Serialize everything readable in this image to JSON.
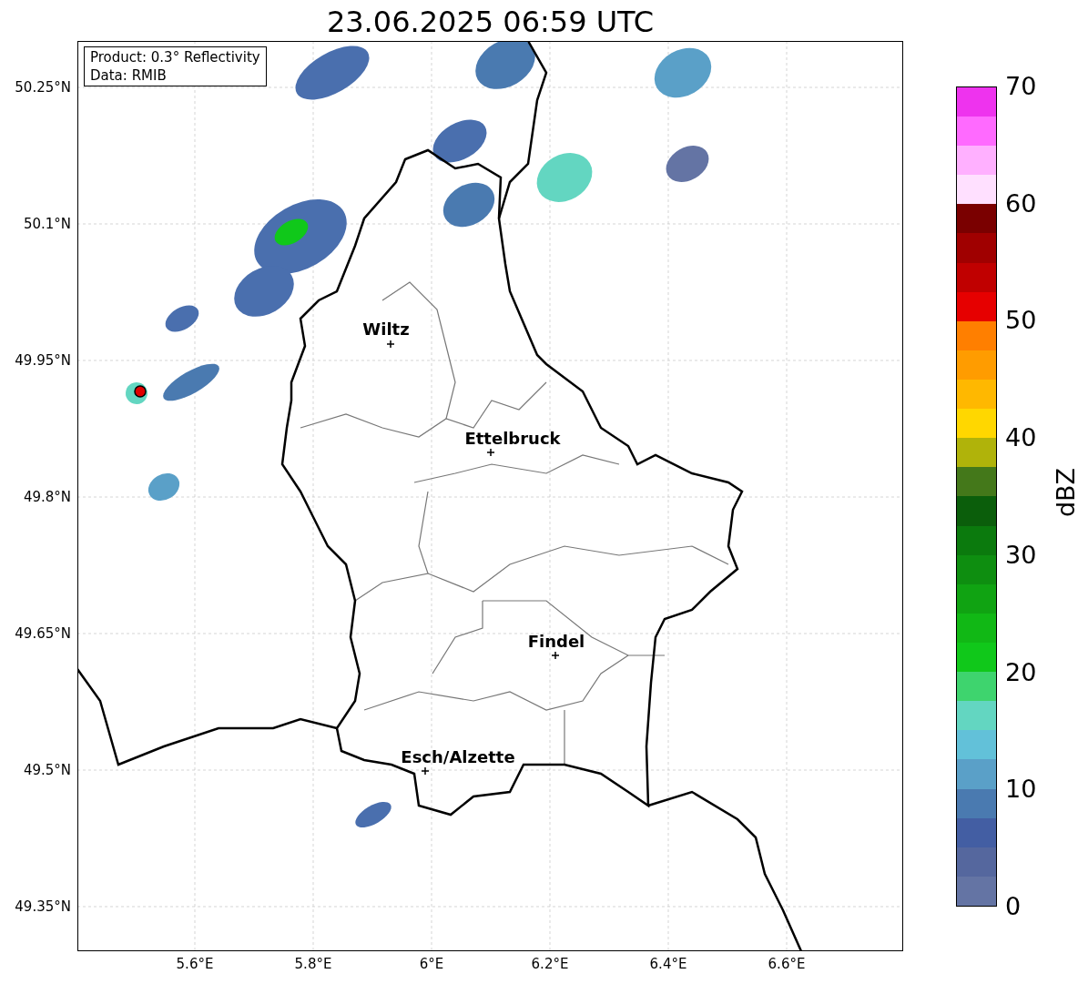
{
  "title": "23.06.2025 06:59 UTC",
  "info_box": [
    "Product: 0.3° Reflectivity",
    "Data: RMIB"
  ],
  "y_ticks": [
    "50.25°N",
    "50.1°N",
    "49.95°N",
    "49.8°N",
    "49.65°N",
    "49.5°N",
    "49.35°N"
  ],
  "x_ticks": [
    "5.6°E",
    "5.8°E",
    "6°E",
    "6.2°E",
    "6.4°E",
    "6.6°E"
  ],
  "cities": [
    {
      "name": "Wiltz"
    },
    {
      "name": "Ettelbruck"
    },
    {
      "name": "Findel"
    },
    {
      "name": "Esch/Alzette"
    }
  ],
  "colorbar": {
    "label": "dBZ",
    "ticks": [
      "70",
      "60",
      "50",
      "40",
      "30",
      "20",
      "10",
      "0"
    ],
    "bands": [
      {
        "color": "#6474a4"
      },
      {
        "color": "#55679e"
      },
      {
        "color": "#435ea3"
      },
      {
        "color": "#4a7ab0"
      },
      {
        "color": "#5aa0c8"
      },
      {
        "color": "#62c1d9"
      },
      {
        "color": "#63d6c1"
      },
      {
        "color": "#3ed46e"
      },
      {
        "color": "#10c81a"
      },
      {
        "color": "#11b815"
      },
      {
        "color": "#10a312"
      },
      {
        "color": "#0e8e10"
      },
      {
        "color": "#0b7a0d"
      },
      {
        "color": "#0b5e0b"
      },
      {
        "color": "#44781a"
      },
      {
        "color": "#b0b30a"
      },
      {
        "color": "#ffd700"
      },
      {
        "color": "#ffb800"
      },
      {
        "color": "#ff9c00"
      },
      {
        "color": "#ff7f00"
      },
      {
        "color": "#e60000"
      },
      {
        "color": "#c00000"
      },
      {
        "color": "#a00000"
      },
      {
        "color": "#7a0000"
      },
      {
        "color": "#ffe0ff"
      },
      {
        "color": "#ffb0ff"
      },
      {
        "color": "#ff6aff"
      },
      {
        "color": "#ee33ee"
      }
    ]
  }
}
